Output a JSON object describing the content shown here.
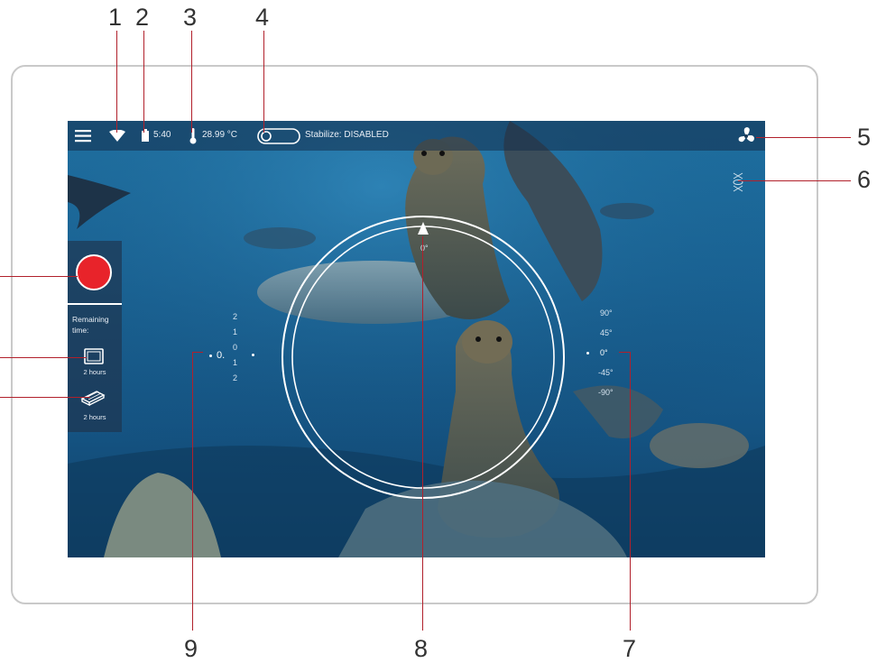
{
  "callouts": [
    "1",
    "2",
    "3",
    "4",
    "5",
    "6",
    "7",
    "8",
    "9"
  ],
  "topbar": {
    "battery_level": "5:40",
    "temperature": "28.99 °C",
    "stabilize_label": "Stabilize: DISABLED"
  },
  "left_panel": {
    "remaining_label": "Remaining time:",
    "screen_time": "2 hours",
    "storage_time": "2 hours"
  },
  "compass_heading": "0°",
  "pitch_scale": [
    "90°",
    "45°",
    "0°",
    "-45°",
    "-90°"
  ],
  "depth_scale": [
    "2",
    "1",
    "0",
    "1",
    "2"
  ],
  "depth_value": "0.",
  "colors": {
    "record_red": "#e8232a",
    "leader_red": "#b1202b",
    "hud_white": "#ffffff"
  },
  "icons": [
    "menu-icon",
    "wifi-icon",
    "battery-icon",
    "thermometer-icon",
    "toggle-icon",
    "fan-icon",
    "propeller-icon",
    "screen-icon",
    "storage-icon",
    "compass-arrow-icon"
  ]
}
